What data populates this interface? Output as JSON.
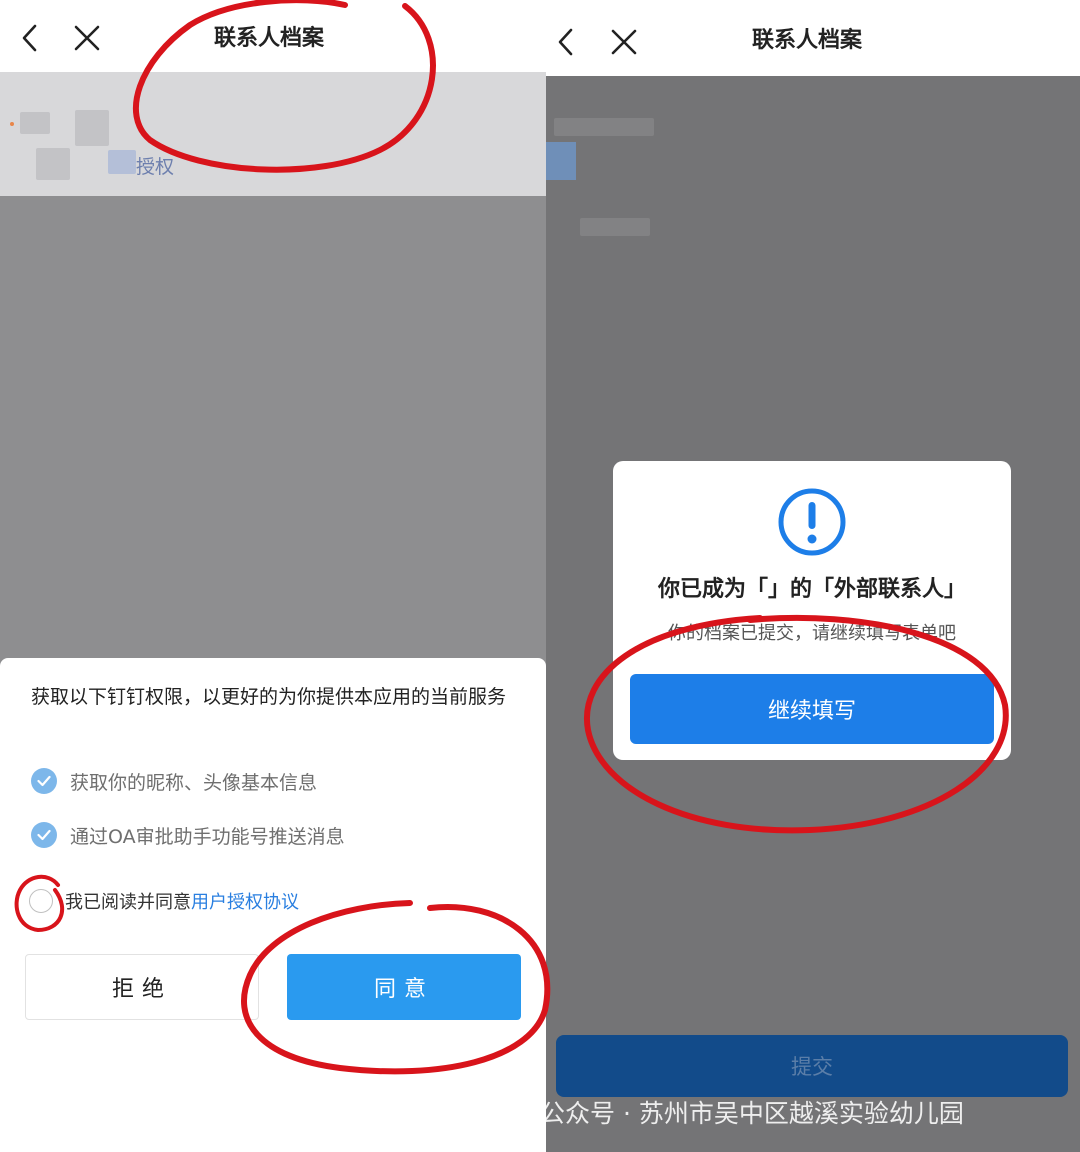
{
  "left": {
    "nav": {
      "back_icon": "chevron-left-icon",
      "close_icon": "close-icon",
      "title": "联系人档案"
    },
    "blurred_link": "授权",
    "sheet": {
      "heading": "获取以下钉钉权限，以更好的为你提供本应用的当前服务",
      "permissions": [
        "获取你的昵称、头像基本信息",
        "通过OA审批助手功能号推送消息"
      ],
      "agree_prefix": "我已阅读并同意",
      "agree_link": "用户授权协议",
      "reject_label": "拒绝",
      "agree_label": "同意"
    }
  },
  "right": {
    "nav": {
      "back_icon": "chevron-left-icon",
      "close_icon": "close-icon",
      "title": "联系人档案"
    },
    "dialog": {
      "icon": "alert-circle-icon",
      "title": "你已成为「」的「外部联系人」",
      "subtitle": "你的档案已提交，请继续填写表单吧",
      "continue_label": "继续填写"
    },
    "submit_label": "提交"
  },
  "watermark": {
    "text": "公众号 · 苏州市吴中区越溪实验幼儿园",
    "icon": "wechat-icon"
  },
  "colors": {
    "accent_blue": "#2a9aef",
    "dialog_blue": "#1d7ee8",
    "annotation_red": "#d8141b"
  }
}
